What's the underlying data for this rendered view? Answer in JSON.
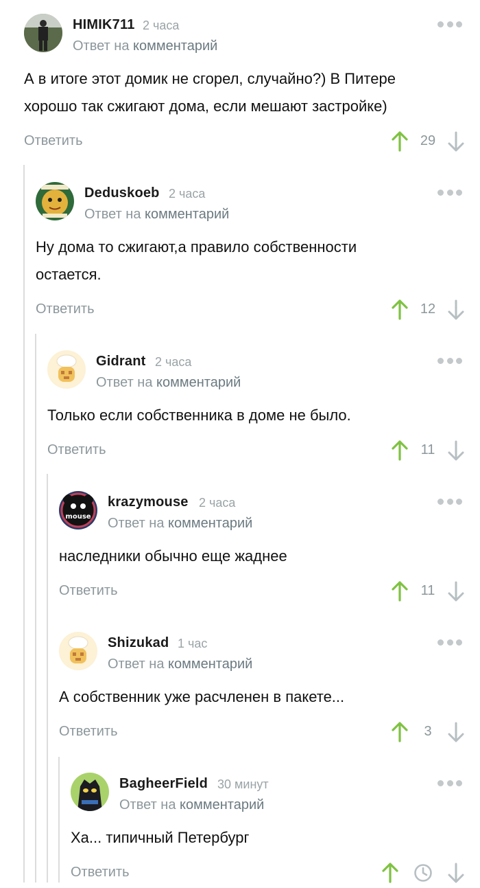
{
  "reply_prefix": "Ответ на",
  "reply_link": "комментарий",
  "answer_label": "Ответить",
  "colors": {
    "upvote": "#7fc242",
    "muted": "#8c979b",
    "thread_line": "#dcdcdc"
  },
  "comments": [
    {
      "username": "HIMIK711",
      "time": "2 часа",
      "text_lines": [
        "А в итоге этот домик не сгорел, случайно?) В Питере",
        "хорошо так сжигают дома, если мешают застройке)"
      ],
      "score": "29",
      "avatar": "soldier-photo-avatar"
    },
    {
      "username": "Deduskoeb",
      "time": "2 часа",
      "text_lines": [
        "Ну дома то сжигают,а правило собственности",
        "остается."
      ],
      "score": "12",
      "avatar": "cartoon-avatar"
    },
    {
      "username": "Gidrant",
      "time": "2 часа",
      "text_lines": [
        "Только если собственника в доме не было."
      ],
      "score": "11",
      "avatar": "default-chef-avatar"
    },
    {
      "username": "krazymouse",
      "time": "2 часа",
      "text_lines": [
        "наследники обычно еще жаднее"
      ],
      "score": "11",
      "avatar": "mouse-avatar",
      "avatar_text": "mouse"
    },
    {
      "username": "Shizukad",
      "time": "1 час",
      "text_lines": [
        "А собственник уже расчленен в пакете..."
      ],
      "score": "3",
      "avatar": "default-chef-avatar"
    },
    {
      "username": "BagheerField",
      "time": "30 минут",
      "text_lines": [
        "Ха... типичный Петербург"
      ],
      "score": null,
      "score_icon": "clock-icon",
      "avatar": "panther-avatar"
    }
  ]
}
